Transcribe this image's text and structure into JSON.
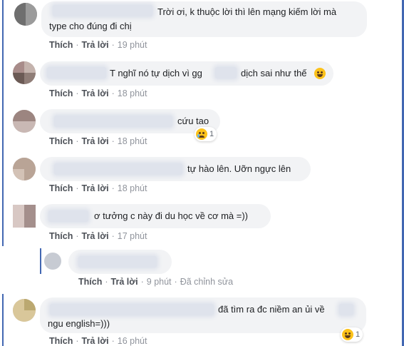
{
  "actions": {
    "like": "Thích",
    "reply": "Trả lời",
    "edited": "Đã chỉnh sửa"
  },
  "comments": [
    {
      "text": "Trời ơi, k thuộc lời thì lên mạng kiếm lời mà",
      "text2": "type cho đúng đi chị",
      "time": "19 phút"
    },
    {
      "text": "T nghĩ nó tự dịch vì gg",
      "text_after": "dịch sai như thế",
      "time": "18 phút"
    },
    {
      "text": "cứu tao",
      "time": "18 phút",
      "reaction_count": "1"
    },
    {
      "text": "tự hào lên. Uỡn ngực lên",
      "time": "18 phút"
    },
    {
      "text": "ơ tưởng c này đi du học về cơ mà =))",
      "time": "17 phút"
    },
    {
      "text": "",
      "time": "9 phút"
    },
    {
      "text": "đã tìm ra đc niềm an ủi về",
      "text2": "ngu english=)))",
      "time": "16 phút",
      "reaction_count": "1"
    }
  ],
  "icons": {
    "sad": "sad-emoji-icon",
    "laugh": "laughing-emoji-icon"
  },
  "colors": {
    "accent": "#4267b2",
    "bubble": "#f2f3f5",
    "link": "#4b4f56"
  }
}
